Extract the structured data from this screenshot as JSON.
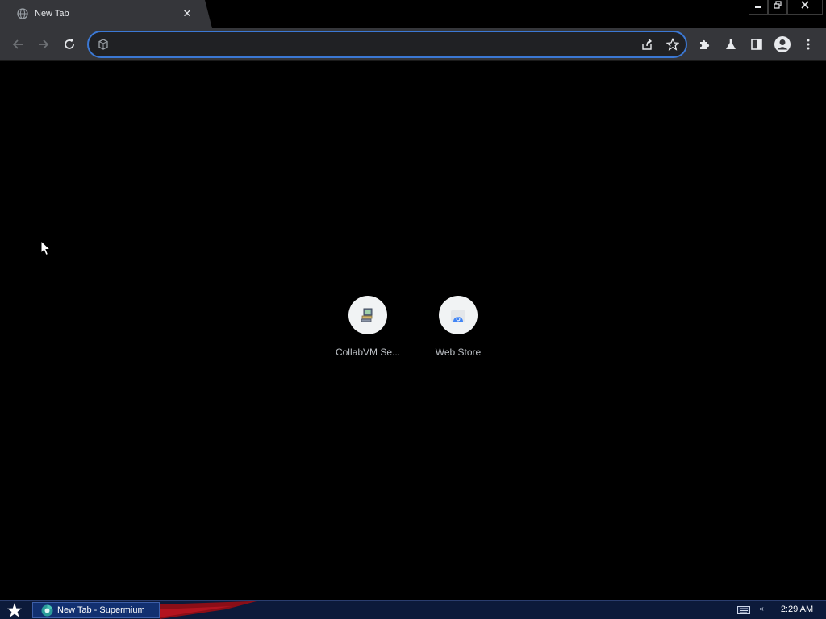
{
  "tab": {
    "title": "New Tab",
    "close_glyph": "✕",
    "favicon": "globe-icon"
  },
  "window_controls": {
    "minimize": "🗕",
    "restore": "🗗",
    "close": "✕"
  },
  "toolbar": {
    "back_icon": "back-arrow-icon",
    "forward_icon": "forward-arrow-icon",
    "reload_icon": "reload-icon",
    "extensions_icon": "puzzle-icon",
    "labs_icon": "flask-icon",
    "side_panel_icon": "side-panel-icon",
    "profile_icon": "avatar-icon",
    "menu_icon": "kebab-menu-icon"
  },
  "omnibox": {
    "value": "",
    "placeholder": "",
    "accent": "#3b78d4"
  },
  "shortcuts": [
    {
      "label": "CollabVM Se...",
      "icon": "computer-icon"
    },
    {
      "label": "Web Store",
      "icon": "web-store-icon"
    }
  ],
  "taskbar": {
    "task_label": "New Tab - Supermium",
    "clock": "2:29 AM",
    "start_icon": "star-start-icon",
    "tray_chevron": "«"
  },
  "colors": {
    "background": "#000000",
    "toolbar": "#35363a",
    "taskbar": "#0c1a3a"
  }
}
